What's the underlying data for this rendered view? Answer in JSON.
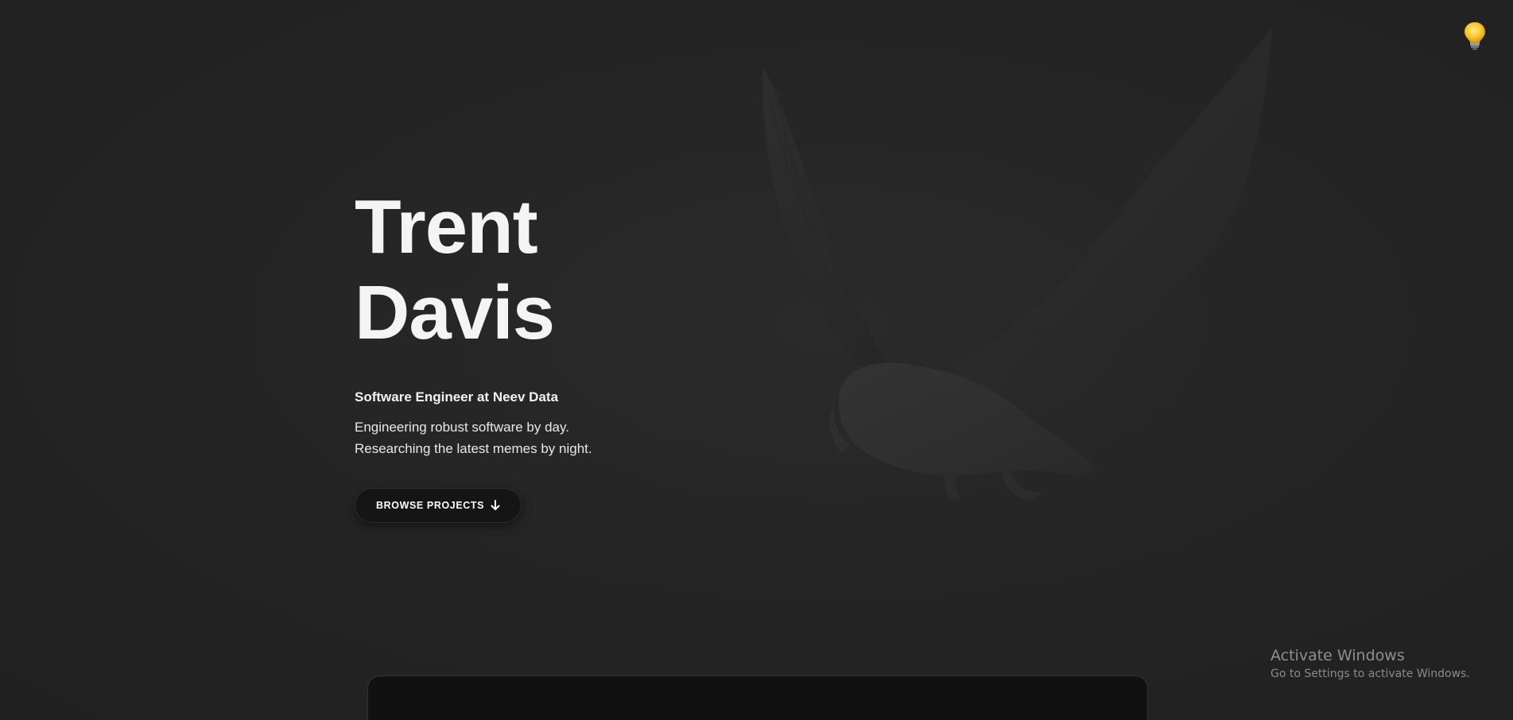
{
  "header": {
    "theme_toggle_icon": "lightbulb-icon"
  },
  "hero": {
    "name_line1": "Trent",
    "name_line2": "Davis",
    "role": "Software Engineer at Neev Data",
    "tagline_line1": "Engineering robust software by day.",
    "tagline_line2": "Researching the latest memes by night.",
    "cta_label": "BROWSE PROJECTS",
    "cta_icon": "arrow-down-icon",
    "background_image": "bird-illustration"
  },
  "system_overlay": {
    "title": "Activate Windows",
    "subtitle": "Go to Settings to activate Windows."
  },
  "colors": {
    "background": "#252525",
    "text": "#f4f4f4",
    "button_bg": "#151515"
  }
}
